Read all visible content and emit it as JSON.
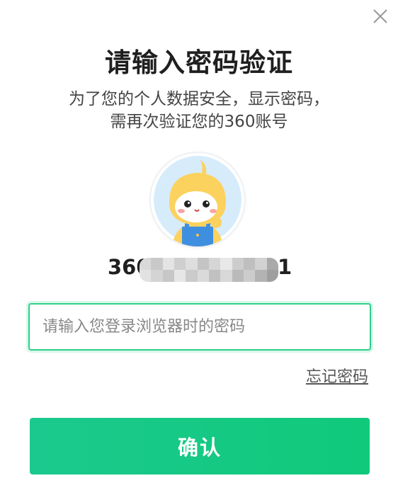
{
  "dialog": {
    "title": "请输入密码验证",
    "description_line1": "为了您的个人数据安全，显示密码，",
    "description_line2": "需再次验证您的360账号"
  },
  "account": {
    "visible_prefix": "360",
    "visible_suffix": "1"
  },
  "password_field": {
    "value": "",
    "placeholder": "请输入您登录浏览器时的密码"
  },
  "links": {
    "forgot_password": "忘记密码"
  },
  "buttons": {
    "confirm": "确认"
  },
  "icons": {
    "close": "close-icon",
    "avatar": "mascot-avatar"
  },
  "colors": {
    "accent": "#10c97a",
    "input_border": "#2fd08a",
    "title_text": "#1f1f1f"
  }
}
